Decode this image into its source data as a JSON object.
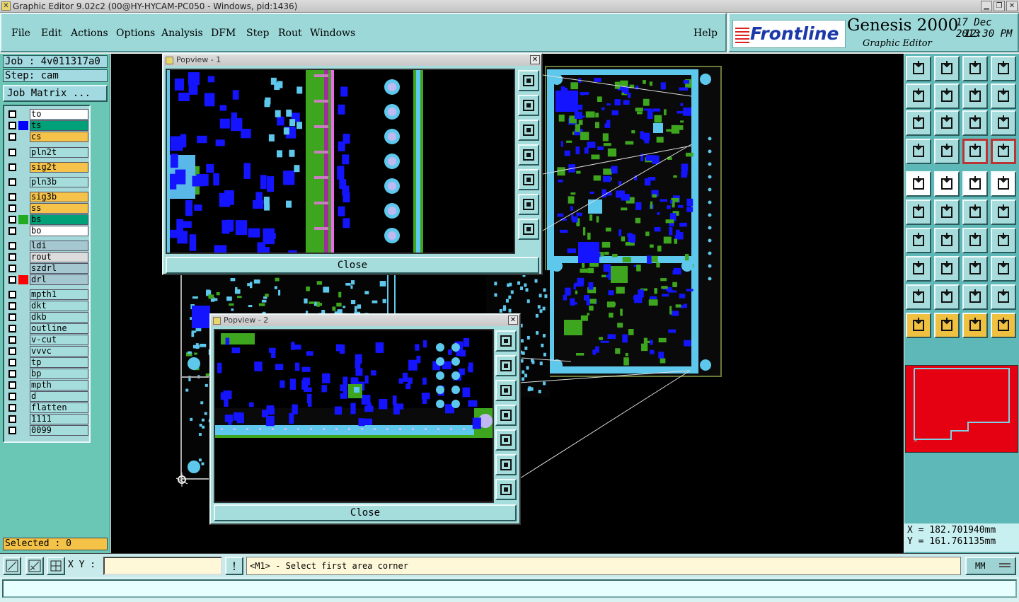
{
  "window": {
    "title": "Graphic Editor 9.02c2 (00@HY-HYCAM-PC050 - Windows, pid:1436)"
  },
  "menu": {
    "items": [
      "File",
      "Edit",
      "Actions",
      "Options",
      "Analysis",
      "DFM",
      "Step",
      "Rout",
      "Windows"
    ],
    "help": "Help"
  },
  "brand": {
    "logo": "Frontline",
    "product": "Genesis 2000",
    "subtitle": "Graphic Editor",
    "date": "17 Dec 2013",
    "time": "12:30 PM"
  },
  "job": {
    "label": "Job : 4v011317a0",
    "step": "Step: cam",
    "matrix": "Job Matrix ..."
  },
  "layers": [
    {
      "name": "to",
      "color": "#ffffff",
      "swatch": ""
    },
    {
      "name": "ts",
      "color": "#00a078",
      "swatch": "#0000ff"
    },
    {
      "name": "cs",
      "color": "#f5c24a",
      "swatch": ""
    },
    {
      "name": "pln2t",
      "color": "#a5dcdc",
      "swatch": ""
    },
    {
      "name": "sig2t",
      "color": "#f5c24a",
      "swatch": ""
    },
    {
      "name": "pln3b",
      "color": "#a5dcdc",
      "swatch": ""
    },
    {
      "name": "sig3b",
      "color": "#f5c24a",
      "swatch": ""
    },
    {
      "name": "ss",
      "color": "#f5c24a",
      "swatch": ""
    },
    {
      "name": "bs",
      "color": "#00a078",
      "swatch": "#22aa22"
    },
    {
      "name": "bo",
      "color": "#ffffff",
      "swatch": ""
    },
    {
      "name": "ldi",
      "color": "#a5c8d0",
      "swatch": ""
    },
    {
      "name": "rout",
      "color": "#dcdcdc",
      "swatch": ""
    },
    {
      "name": "szdrl",
      "color": "#a5c8d0",
      "swatch": ""
    },
    {
      "name": "drl",
      "color": "#a5c8d0",
      "swatch": "#ff0000"
    },
    {
      "name": "mpth1",
      "color": "#a5dcdc",
      "swatch": ""
    },
    {
      "name": "dkt",
      "color": "#a5dcdc",
      "swatch": ""
    },
    {
      "name": "dkb",
      "color": "#a5dcdc",
      "swatch": ""
    },
    {
      "name": "outline",
      "color": "#a5dcdc",
      "swatch": ""
    },
    {
      "name": "v-cut",
      "color": "#a5dcdc",
      "swatch": ""
    },
    {
      "name": "vvvc",
      "color": "#a5dcdc",
      "swatch": ""
    },
    {
      "name": "tp",
      "color": "#a5dcdc",
      "swatch": ""
    },
    {
      "name": "bp",
      "color": "#a5dcdc",
      "swatch": ""
    },
    {
      "name": "mpth",
      "color": "#a5dcdc",
      "swatch": ""
    },
    {
      "name": "d",
      "color": "#a5dcdc",
      "swatch": ""
    },
    {
      "name": "flatten",
      "color": "#a5dcdc",
      "swatch": ""
    },
    {
      "name": "1111",
      "color": "#a5dcdc",
      "swatch": ""
    },
    {
      "name": "0099",
      "color": "#a5dcdc",
      "swatch": ""
    }
  ],
  "selected": "Selected : 0",
  "popview1": {
    "title": "Popview - 1",
    "close": "Close"
  },
  "popview2": {
    "title": "Popview - 2",
    "close": "Close"
  },
  "coords": {
    "x": "X = 182.701940mm",
    "y": "Y = 161.761135mm"
  },
  "cmd": {
    "xy_label": "X Y :",
    "xy_value": "",
    "bang": "!",
    "prompt": "<M1> - Select first area corner",
    "units": "MM"
  },
  "colors": {
    "accent": "#9cd8d8",
    "canvas": "#000000",
    "copper_top": "#1414ff",
    "copper_bottom": "#3ea61e",
    "pad": "#5ec8ec"
  },
  "toolbar_icons": [
    "zoom-home-icon",
    "measure-icon",
    "layers-icon",
    "select-icon"
  ]
}
